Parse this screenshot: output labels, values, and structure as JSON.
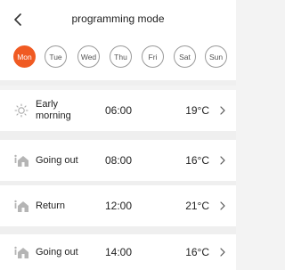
{
  "header": {
    "back_icon": "chevron-left-icon",
    "title": "programming mode"
  },
  "days": [
    {
      "label": "Mon",
      "active": true
    },
    {
      "label": "Tue",
      "active": false
    },
    {
      "label": "Wed",
      "active": false
    },
    {
      "label": "Thu",
      "active": false
    },
    {
      "label": "Fri",
      "active": false
    },
    {
      "label": "Sat",
      "active": false
    },
    {
      "label": "Sun",
      "active": false
    }
  ],
  "schedule": [
    {
      "icon": "sun-icon",
      "label": "Early morning",
      "time": "06:00",
      "temperature": "19°C"
    },
    {
      "icon": "away-home-icon",
      "label": "Going out",
      "time": "08:00",
      "temperature": "16°C"
    },
    {
      "icon": "return-home-icon",
      "label": "Return",
      "time": "12:00",
      "temperature": "21°C"
    },
    {
      "icon": "away-home-icon",
      "label": "Going out",
      "time": "14:00",
      "temperature": "16°C"
    }
  ],
  "colors": {
    "accent": "#f05a22",
    "background": "#f3f3f3",
    "card": "#ffffff"
  }
}
